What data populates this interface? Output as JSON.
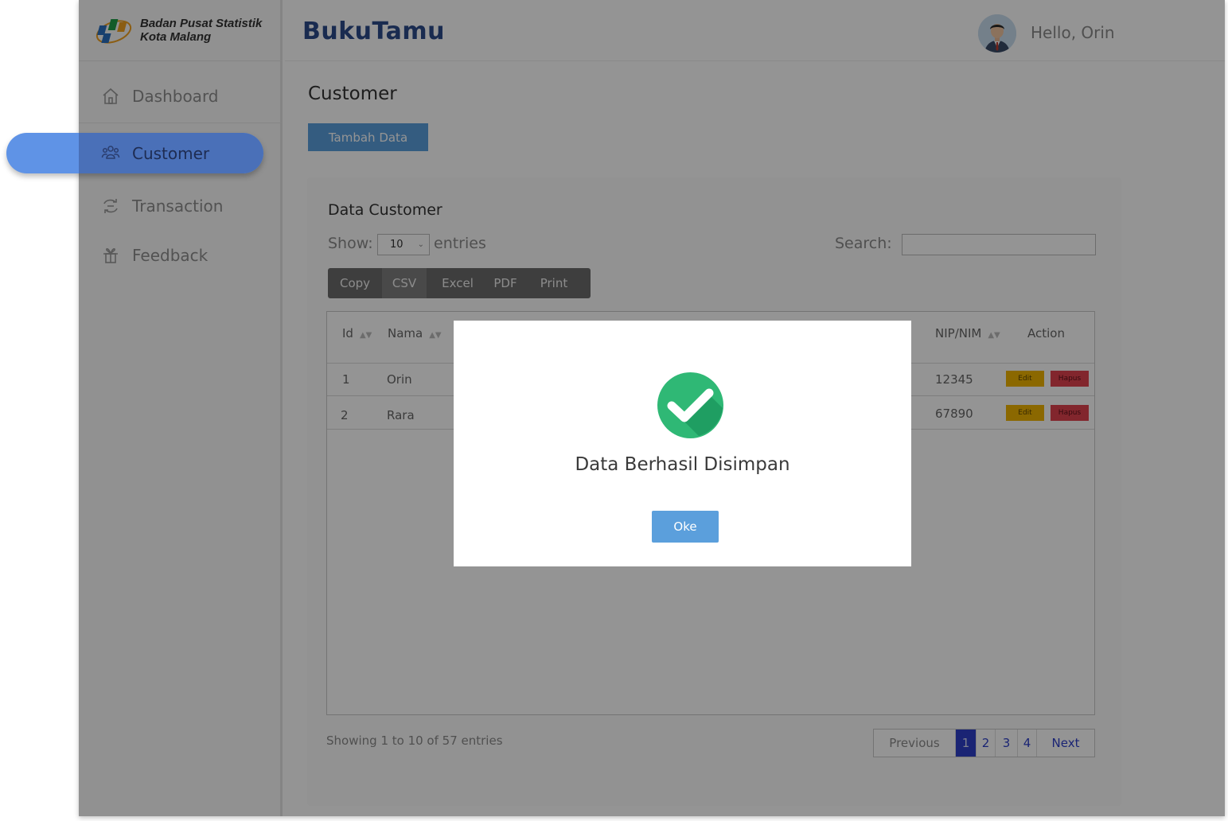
{
  "brand": {
    "org_line1": "Badan Pusat Statistik",
    "org_line2": "Kota Malang",
    "logo_icon": "bps-logo"
  },
  "header": {
    "app_title": "BukuTamu",
    "greeting": "Hello, Orin",
    "avatar_icon": "user-avatar"
  },
  "sidebar": {
    "items": [
      {
        "label": "Dashboard",
        "icon": "home-icon"
      },
      {
        "label": "Customer",
        "icon": "users-icon",
        "active": true
      },
      {
        "label": "Transaction",
        "icon": "transaction-icon"
      },
      {
        "label": "Feedback",
        "icon": "feedback-icon"
      }
    ]
  },
  "main": {
    "page_title": "Customer",
    "add_button": "Tambah Data",
    "card_title": "Data Customer",
    "show_label": "Show:",
    "length_value": "10",
    "entries_label": "entries",
    "search_label": "Search:",
    "search_value": "",
    "export_buttons": [
      "Copy",
      "CSV",
      "Excel",
      "PDF",
      "Print"
    ],
    "columns": [
      "Id",
      "Nama",
      "NIP/NIM",
      "Action"
    ],
    "rows": [
      {
        "id": "1",
        "nama": "Orin",
        "nip": "12345",
        "edit": "Edit",
        "delete": "Hapus"
      },
      {
        "id": "2",
        "nama": "Rara",
        "nip": "67890",
        "edit": "Edit",
        "delete": "Hapus"
      }
    ],
    "info": "Showing 1 to 10 of 57 entries",
    "pagination": {
      "previous": "Previous",
      "pages": [
        "1",
        "2",
        "3",
        "4"
      ],
      "current": "1",
      "next": "Next"
    }
  },
  "modal": {
    "message": "Data Berhasil Disimpan",
    "ok_button": "Oke",
    "icon": "check-circle-icon"
  },
  "colors": {
    "primary": "#5b9fdc",
    "title": "#2c4a8a",
    "success": "#2fb875",
    "edit": "#f0b400",
    "delete": "#e0434f",
    "active_nav": "#5f93e6"
  }
}
